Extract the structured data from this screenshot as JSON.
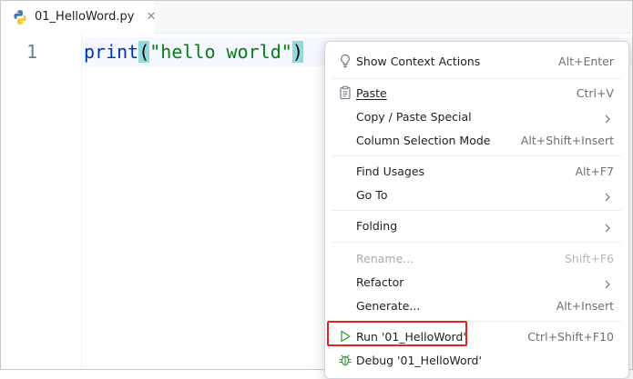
{
  "tab": {
    "filename": "01_HelloWord.py",
    "close_glyph": "✕",
    "icon": "python-file-icon"
  },
  "editor": {
    "line_number": "1",
    "code": {
      "fn": "print",
      "open_paren": "(",
      "string": "\"hello world\"",
      "close_paren": ")"
    }
  },
  "menu": {
    "items": [
      {
        "label": "Show Context Actions",
        "shortcut": "Alt+Enter",
        "icon": "lightbulb-icon"
      },
      {
        "label": "Paste",
        "shortcut": "Ctrl+V",
        "icon": "clipboard-icon"
      },
      {
        "label": "Copy / Paste Special",
        "submenu": true
      },
      {
        "label": "Column Selection Mode",
        "shortcut": "Alt+Shift+Insert"
      },
      {
        "label": "Find Usages",
        "shortcut": "Alt+F7"
      },
      {
        "label": "Go To",
        "submenu": true
      },
      {
        "label": "Folding",
        "submenu": true
      },
      {
        "label": "Rename...",
        "shortcut": "Shift+F6",
        "disabled": true
      },
      {
        "label": "Refactor",
        "submenu": true
      },
      {
        "label": "Generate...",
        "shortcut": "Alt+Insert"
      },
      {
        "label": "Run '01_HelloWord'",
        "shortcut": "Ctrl+Shift+F10",
        "icon": "run-play-icon"
      },
      {
        "label": "Debug '01_HelloWord'",
        "icon": "debug-bug-icon"
      }
    ]
  },
  "colors": {
    "highlight_box": "#e3221b",
    "run_icon": "#3c9a3c",
    "string": "#067d17",
    "keyword": "#0033b3",
    "paren_match": "#93d9d9"
  }
}
